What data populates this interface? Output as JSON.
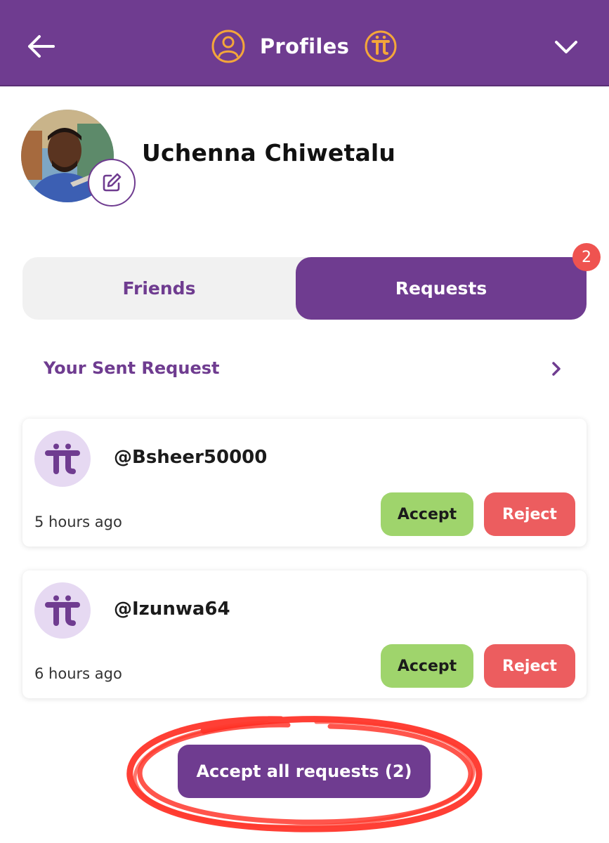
{
  "header": {
    "title": "Profiles",
    "back_icon": "arrow-left-icon",
    "profile_icon": "user-circle-icon",
    "pi_icon": "pi-coin-icon",
    "menu_icon": "chevron-down-icon"
  },
  "profile": {
    "name": "Uchenna Chiwetalu",
    "avatar_icon": "avatar-portrait",
    "edit_icon": "pencil-edit-icon"
  },
  "tabs": [
    {
      "label": "Friends",
      "active": false
    },
    {
      "label": "Requests",
      "active": true,
      "badge": "2"
    }
  ],
  "sent_request": {
    "label": "Your Sent Request",
    "icon": "chevron-right-icon"
  },
  "requests": [
    {
      "handle": "@Bsheer50000",
      "time": "5 hours ago",
      "accept": "Accept",
      "reject": "Reject"
    },
    {
      "handle": "@Izunwa64",
      "time": "6 hours ago",
      "accept": "Accept",
      "reject": "Reject"
    }
  ],
  "accept_all_label": "Accept all requests (2)",
  "colors": {
    "brand": "#6f3c90",
    "accent": "#f4a63a",
    "accept": "#9fd46c",
    "reject": "#ec5d5f",
    "badge": "#ef5350",
    "annotation": "#ff2a1f"
  }
}
